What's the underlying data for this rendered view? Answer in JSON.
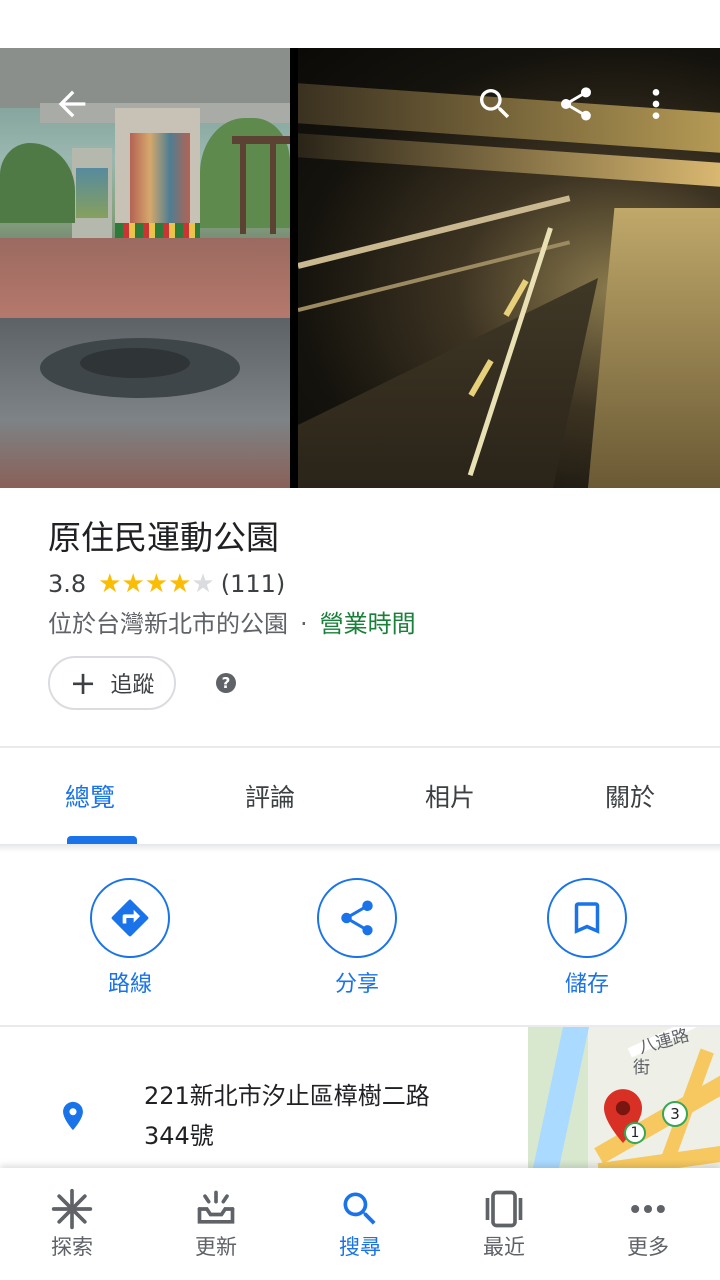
{
  "place": {
    "title": "原住民運動公園",
    "rating": "3.8",
    "rating_value": 3.8,
    "review_count": "(111)",
    "category": "位於台灣新北市的公園",
    "separator": "·",
    "hours_label": "營業時間",
    "follow_label": "追蹤",
    "help": "?"
  },
  "tabs": [
    {
      "label": "總覽"
    },
    {
      "label": "評論"
    },
    {
      "label": "相片"
    },
    {
      "label": "關於"
    }
  ],
  "actions": {
    "directions": "路線",
    "share": "分享",
    "save": "儲存"
  },
  "address": {
    "line1": "221新北市汐止區樟樹二路",
    "line2": "344號"
  },
  "minimap": {
    "road_label": "八連路",
    "road_label2": "街",
    "marker1": "1",
    "marker3": "3"
  },
  "bottom_nav": [
    {
      "label": "探索",
      "icon": "explore-icon"
    },
    {
      "label": "更新",
      "icon": "updates-icon"
    },
    {
      "label": "搜尋",
      "icon": "search-icon"
    },
    {
      "label": "最近",
      "icon": "recents-icon"
    },
    {
      "label": "更多",
      "icon": "more-icon"
    }
  ],
  "colors": {
    "accent": "#1a73e8",
    "star": "#fbbc04",
    "open": "#188038"
  }
}
